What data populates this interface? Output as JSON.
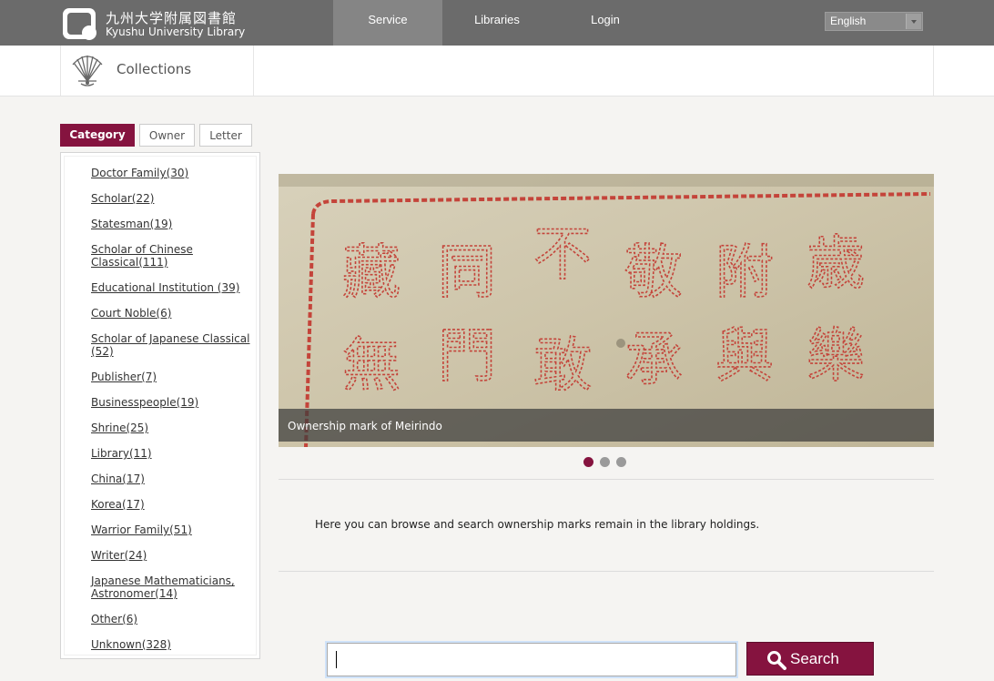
{
  "header": {
    "logo_jp": "九州大学附属図書館",
    "logo_en": "Kyushu University Library",
    "nav": [
      {
        "label": "Service",
        "active": true
      },
      {
        "label": "Libraries",
        "active": false
      },
      {
        "label": "Login",
        "active": false
      }
    ],
    "language": "English"
  },
  "subheader": {
    "title": "Collections"
  },
  "tabs": [
    {
      "label": "Category",
      "active": true
    },
    {
      "label": "Owner",
      "active": false
    },
    {
      "label": "Letter",
      "active": false
    }
  ],
  "categories": [
    "Doctor Family(30)",
    "Scholar(22)",
    "Statesman(19)",
    "Scholar of Chinese Classical(111)",
    "Educational Institution (39)",
    "Court Noble(6)",
    "Scholar of Japanese Classical (52)",
    "Publisher(7)",
    "Businesspeople(19)",
    "Shrine(25)",
    "Library(11)",
    "China(17)",
    "Korea(17)",
    "Warrior Family(51)",
    "Writer(24)",
    "Japanese Mathematicians, Astronomer(14)",
    "Other(6)",
    "Unknown(328)"
  ],
  "slider": {
    "caption": "Ownership mark of Meirindo",
    "stamp_text": [
      "藏",
      "同",
      "不",
      "敬",
      "附",
      "歳",
      "無",
      "門",
      "敢",
      "承",
      "與",
      "樂"
    ],
    "slides": 3,
    "active_slide": 1
  },
  "intro": "Here you can browse and search ownership marks remain in the library holdings.",
  "search": {
    "value": "",
    "button_label": "Search"
  },
  "colors": {
    "accent": "#85133f",
    "topbar": "#6b6b6b",
    "background": "#f5f4f2"
  }
}
